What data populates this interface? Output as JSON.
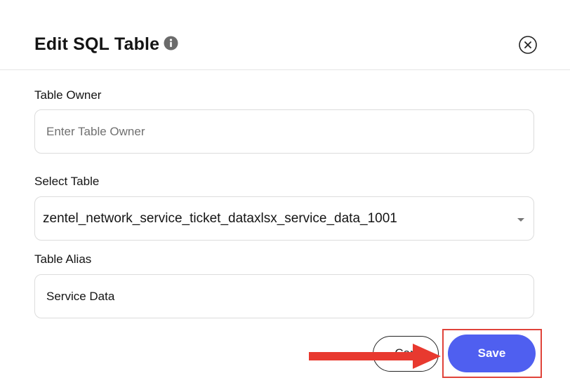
{
  "dialog": {
    "title": "Edit SQL Table",
    "info_icon": "info-circle-icon",
    "close_icon": "close-circle-icon"
  },
  "form": {
    "owner": {
      "label": "Table Owner",
      "placeholder": "Enter Table Owner",
      "value": ""
    },
    "table": {
      "label": "Select Table",
      "selected": "zentel_network_service_ticket_dataxlsx_service_data_1001"
    },
    "alias": {
      "label": "Table Alias",
      "value": "Service Data"
    }
  },
  "actions": {
    "cancel_label": "Can",
    "save_label": "Save"
  },
  "annotation": {
    "arrow_color": "#e8392f",
    "highlight_color": "#e0433a",
    "target": "save-button"
  },
  "colors": {
    "primary": "#4f5ff0",
    "border": "#dcdcdc"
  }
}
